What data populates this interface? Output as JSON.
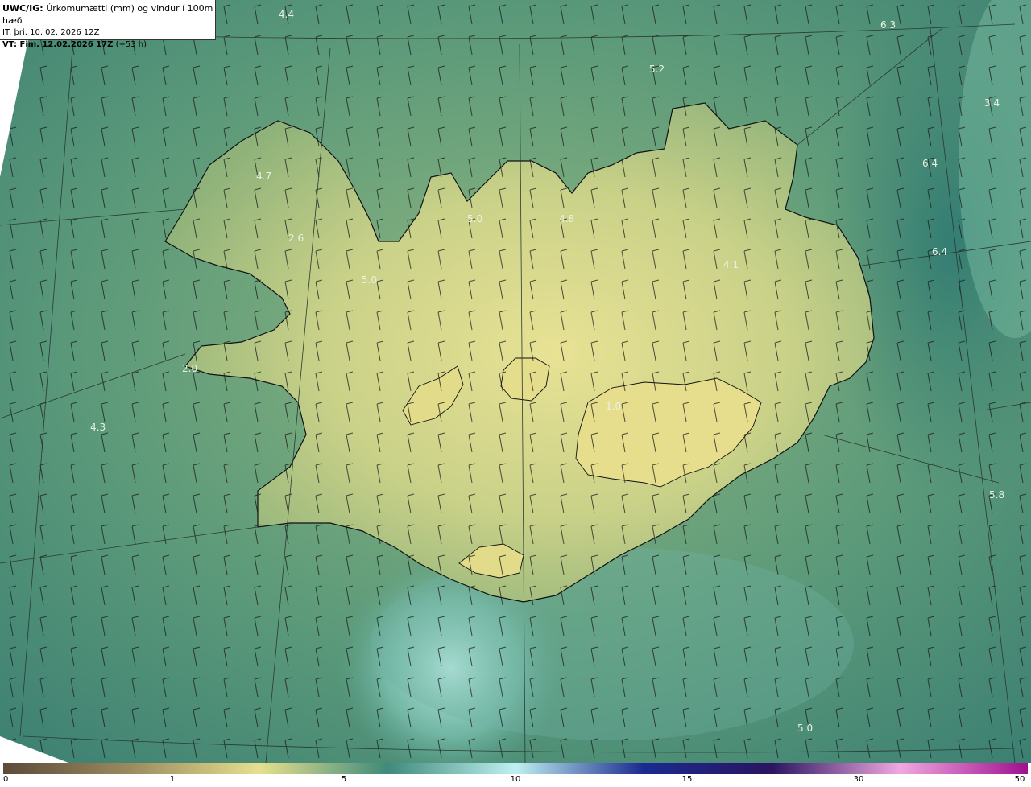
{
  "header": {
    "model": "UWC/IG:",
    "title": "Úrkomumætti (mm) og vindur í 100m hæð",
    "it_line": "IT: þri. 10. 02. 2026 12Z",
    "vt_bold": "VT: Fim. 12.02.2026 17Z",
    "vt_offset": "(+53 h)"
  },
  "map_labels": [
    {
      "text": "4.4",
      "at": "top-left"
    },
    {
      "text": "6.3",
      "at": "top-right"
    },
    {
      "text": "5.2",
      "at": "north-sea"
    },
    {
      "text": "3.4",
      "at": "north-east-sea"
    },
    {
      "text": "6.4",
      "at": "east-sea-north"
    },
    {
      "text": "6.4",
      "at": "east-sea"
    },
    {
      "text": "4.7",
      "at": "westfjords"
    },
    {
      "text": "5.0",
      "at": "north-peninsula"
    },
    {
      "text": "4.8",
      "at": "north-central"
    },
    {
      "text": "2.6",
      "at": "westfjords-south"
    },
    {
      "text": "5.0",
      "at": "northwest-bay"
    },
    {
      "text": "4.1",
      "at": "northeast-land"
    },
    {
      "text": "2.0",
      "at": "snaefellsnes"
    },
    {
      "text": "4.3",
      "at": "west-sea"
    },
    {
      "text": "1.0",
      "at": "vatnajokull"
    },
    {
      "text": "5.8",
      "at": "southeast-sea"
    },
    {
      "text": "5.0",
      "at": "south-sea"
    }
  ],
  "colors": {
    "land_light": "#e3df8f",
    "sea_dark": "#3b7f72",
    "sea_light": "#c8f4ee",
    "barb": "#1a1a1a",
    "coast": "#111111"
  },
  "colorbar": {
    "ticks": [
      {
        "label": "0",
        "value": 0
      },
      {
        "label": "1",
        "value": 1
      },
      {
        "label": "5",
        "value": 5
      },
      {
        "label": "10",
        "value": 10
      },
      {
        "label": "15",
        "value": 15
      },
      {
        "label": "30",
        "value": 30
      },
      {
        "label": "50",
        "value": 50
      }
    ],
    "stops": [
      "#5d4a3a",
      "#9c8b5f",
      "#e6e08e",
      "#3f8a7a",
      "#bff0f0",
      "#1b2a90",
      "#2a1560",
      "#f0a8e0",
      "#a01090"
    ]
  }
}
